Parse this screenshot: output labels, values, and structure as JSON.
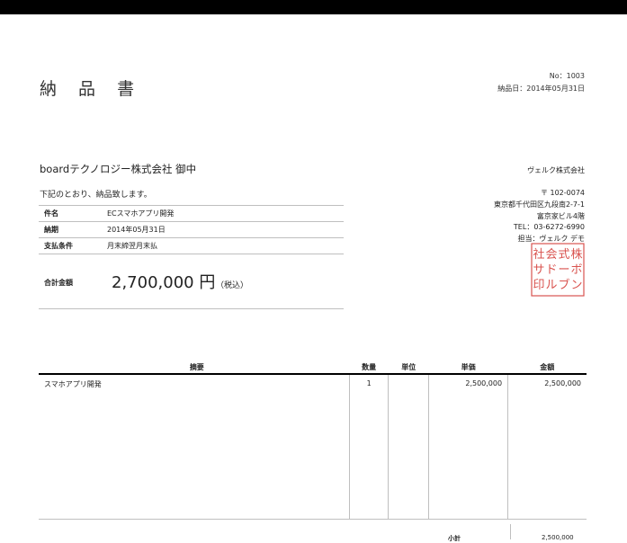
{
  "document": {
    "title": "納 品 書",
    "number": "No：1003",
    "delivery_date": "納品日：2014年05月31日",
    "customer": "boardテクノロジー株式会社 御中",
    "intro": "下記のとおり、納品致します。",
    "info_rows": [
      {
        "label": "件名",
        "value": "ECスマホアプリ開発"
      },
      {
        "label": "納期",
        "value": "2014年05月31日"
      },
      {
        "label": "支払条件",
        "value": "月末締翌月末払"
      }
    ],
    "total": {
      "label": "合計金額",
      "value": "2,700,000 円",
      "tax_note": "（税込）"
    },
    "seller": {
      "company": "ヴェルク株式会社",
      "address_lines": [
        "〒 102-0074",
        "東京都千代田区九段南2-7-1",
        "富京家ビル4階",
        "TEL：03-6272-6990",
        "担当：ヴェルク デモ"
      ]
    },
    "seal": {
      "glyph_lines": [
        "株ボン",
        "式ーブ",
        "会ドル",
        "社サ印"
      ],
      "color": "#d9534f"
    }
  },
  "items_table": {
    "headers": [
      "摘要",
      "数量",
      "単位",
      "単価",
      "金額"
    ],
    "rows": [
      {
        "description": "スマホアプリ開発",
        "quantity": "1",
        "unit": "",
        "unit_price": "2,500,000",
        "amount": "2,500,000"
      }
    ],
    "subtotal_label": "小計",
    "subtotal_value": "2,500,000"
  }
}
